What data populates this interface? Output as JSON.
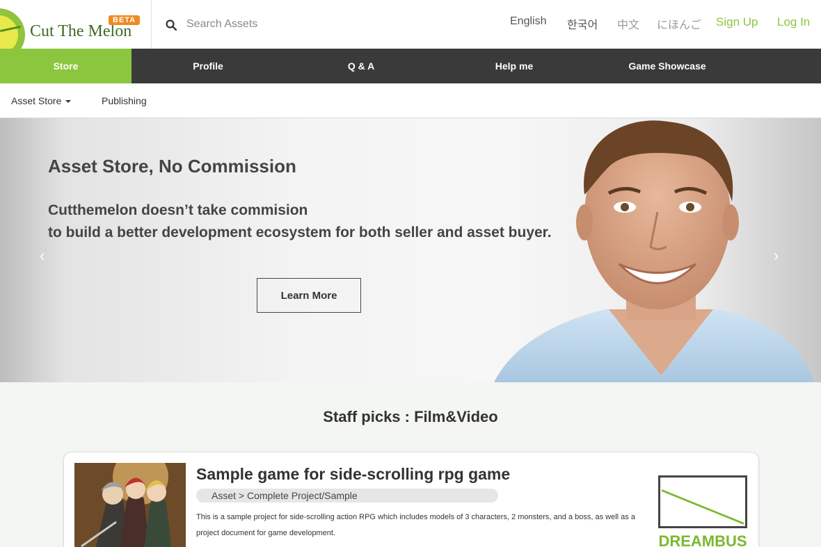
{
  "header": {
    "logo_text": "Cut The Melon",
    "beta_badge": "BETA",
    "search_placeholder": "Search Assets",
    "languages": [
      "English",
      "한국어",
      "中文",
      "にほんご"
    ],
    "sign_up": "Sign Up",
    "log_in": "Log In"
  },
  "main_nav": {
    "items": [
      "Store",
      "Profile",
      "Q & A",
      "Help me",
      "Game Showcase"
    ],
    "active": "Store"
  },
  "sub_nav": {
    "asset_store": "Asset Store",
    "publishing": "Publishing"
  },
  "hero": {
    "title": "Asset Store, No Commission",
    "line1": "Cutthemelon doesn’t take commision",
    "line2": "to build a better development ecosystem for both seller and asset buyer.",
    "button": "Learn More",
    "prev_icon": "‹",
    "next_icon": "›"
  },
  "staff_picks": {
    "title": "Staff picks : Film&Video",
    "card": {
      "title": "Sample game for side-scrolling rpg game",
      "category": "Asset >  Complete Project/Sample",
      "description": "This is a sample project for side-scrolling action RPG which includes models of 3 characters, 2 monsters, and a boss, as well as a project document for game development.",
      "publisher": "DREAMBUS"
    }
  },
  "colors": {
    "accent": "#8cc63f",
    "nav_bg": "#3a3a3a",
    "beta": "#f08a24",
    "logo_text": "#3e6a25"
  }
}
